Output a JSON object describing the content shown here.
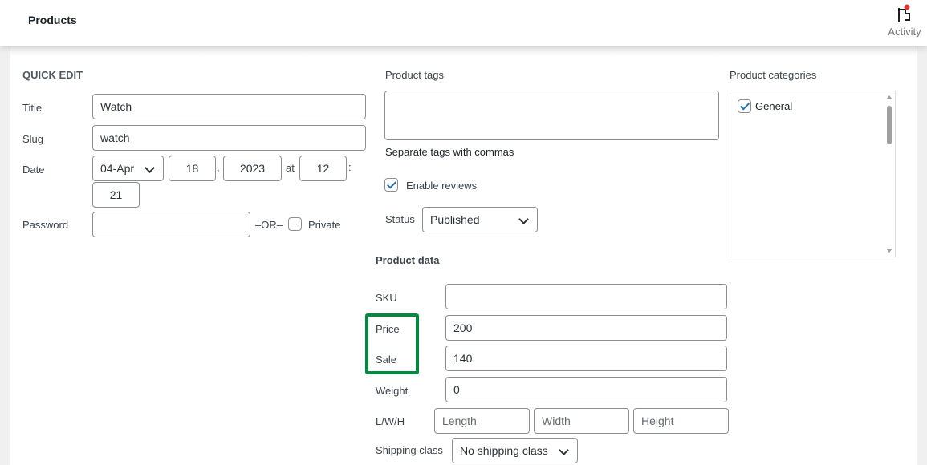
{
  "header": {
    "title": "Products",
    "activity_label": "Activity"
  },
  "quick_edit": {
    "heading": "QUICK EDIT",
    "title_label": "Title",
    "title_value": "Watch",
    "slug_label": "Slug",
    "slug_value": "watch",
    "date_label": "Date",
    "month": "04-Apr",
    "day": "18",
    "day_sep": ",",
    "year": "2023",
    "at": "at",
    "hour": "12",
    "time_sep": ":",
    "minute": "21",
    "password_label": "Password",
    "password_value": "",
    "or_label": "–OR–",
    "private_label": "Private"
  },
  "tags": {
    "label": "Product tags",
    "value": "",
    "hint": "Separate tags with commas",
    "enable_reviews_label": "Enable reviews",
    "status_label": "Status",
    "status_value": "Published"
  },
  "product_data": {
    "heading": "Product data",
    "sku_label": "SKU",
    "sku_value": "",
    "price_label": "Price",
    "price_value": "200",
    "sale_label": "Sale",
    "sale_value": "140",
    "weight_label": "Weight",
    "weight_value": "0",
    "dims_label": "L/W/H",
    "length_placeholder": "Length",
    "width_placeholder": "Width",
    "height_placeholder": "Height",
    "shipping_label": "Shipping class",
    "shipping_value": "No shipping class",
    "highlight_color": "#008a3e"
  },
  "categories": {
    "label": "Product categories",
    "items": [
      {
        "label": "General",
        "checked": true
      }
    ]
  }
}
